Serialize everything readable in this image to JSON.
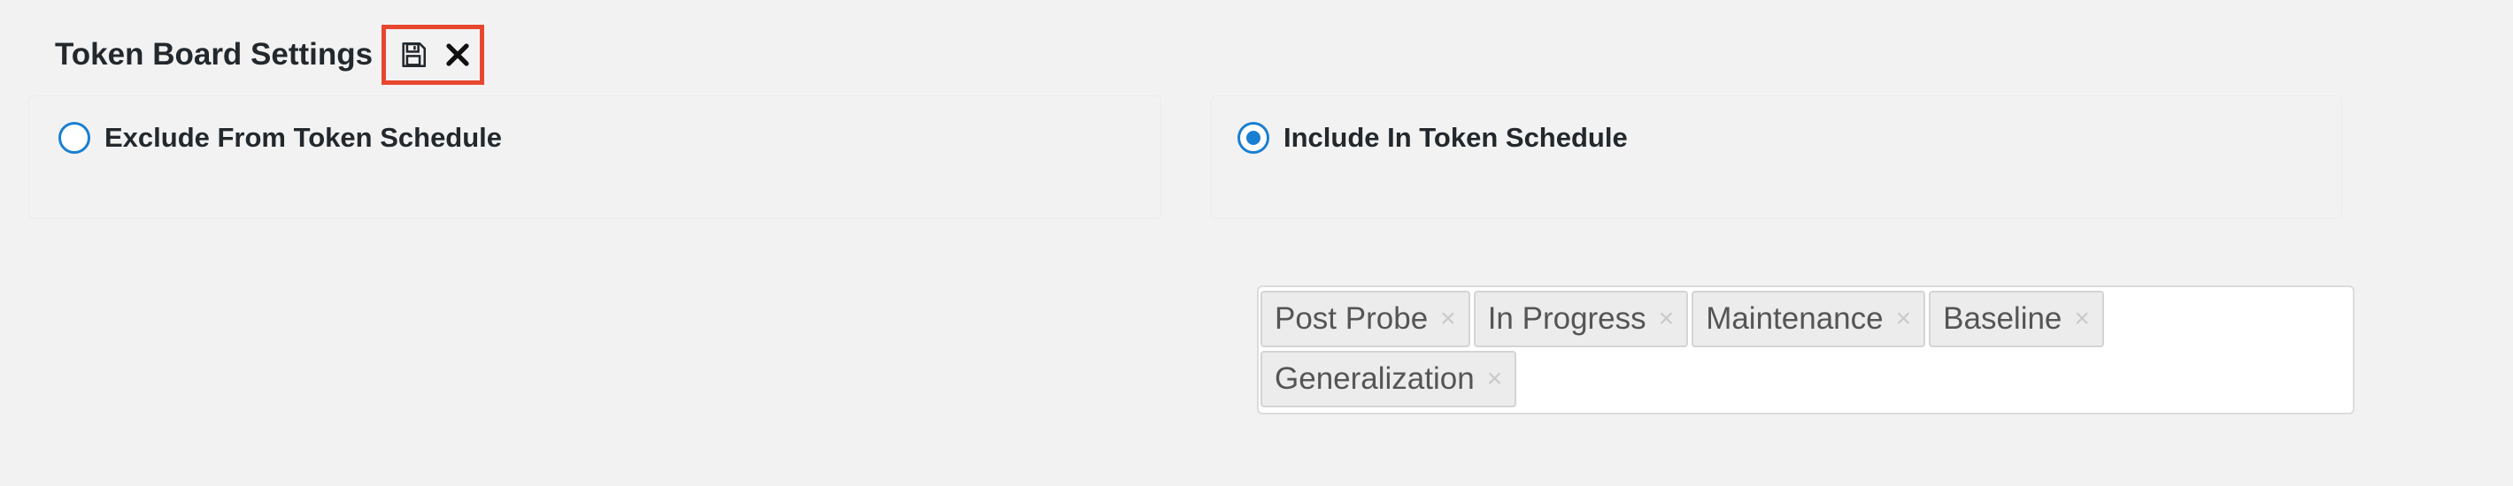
{
  "header": {
    "title": "Token Board Settings",
    "save_icon": "save-icon",
    "close_icon": "close-icon"
  },
  "options": {
    "exclude_label": "Exclude From Token Schedule",
    "include_label": "Include In Token Schedule",
    "selected": "include"
  },
  "tags": [
    {
      "label": "Post Probe",
      "remove": "×"
    },
    {
      "label": "In Progress",
      "remove": "×"
    },
    {
      "label": "Maintenance",
      "remove": "×"
    },
    {
      "label": "Baseline",
      "remove": "×"
    },
    {
      "label": "Generalization",
      "remove": "×"
    }
  ],
  "colors": {
    "accent": "#1a7fd0",
    "highlight_border": "#e8472f",
    "background": "#f2f2f2"
  }
}
